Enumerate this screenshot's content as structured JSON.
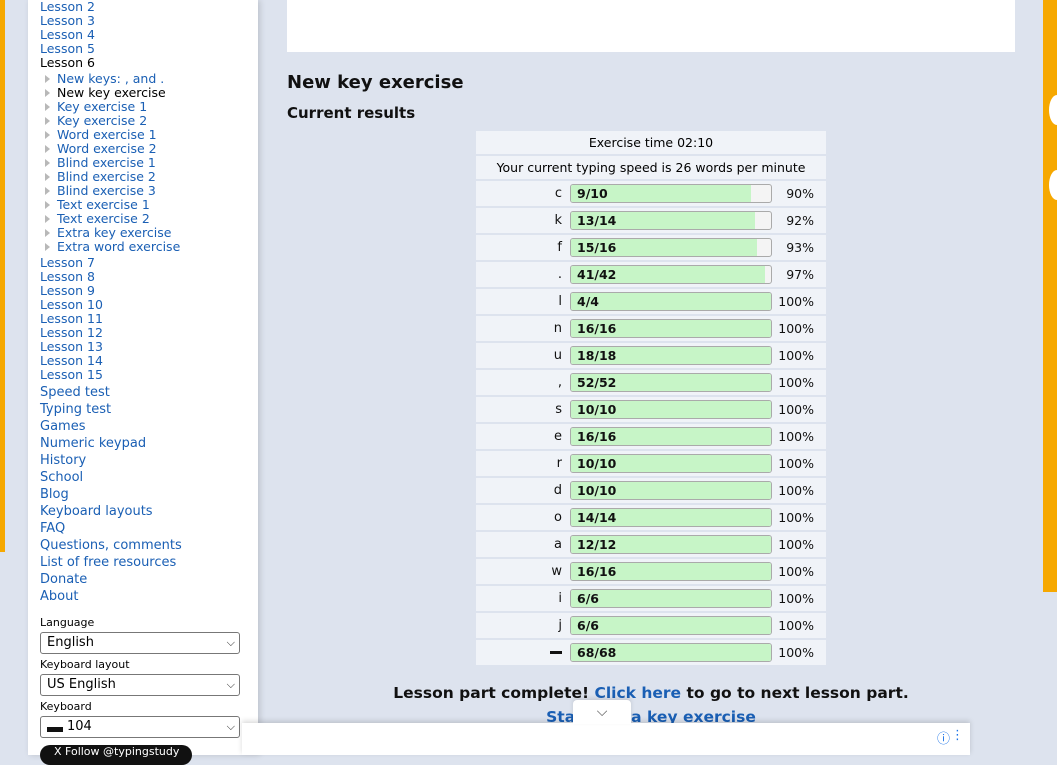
{
  "sidebar": {
    "lessons_before": [
      "Lesson 2",
      "Lesson 3",
      "Lesson 4",
      "Lesson 5"
    ],
    "current_lesson": "Lesson 6",
    "sub_items": [
      "New keys: , and .",
      "New key exercise",
      "Key exercise 1",
      "Key exercise 2",
      "Word exercise 1",
      "Word exercise 2",
      "Blind exercise 1",
      "Blind exercise 2",
      "Blind exercise 3",
      "Text exercise 1",
      "Text exercise 2",
      "Extra key exercise",
      "Extra word exercise"
    ],
    "lessons_after": [
      "Lesson 7",
      "Lesson 8",
      "Lesson 9",
      "Lesson 10",
      "Lesson 11",
      "Lesson 12",
      "Lesson 13",
      "Lesson 14",
      "Lesson 15"
    ],
    "links": [
      "Speed test",
      "Typing test",
      "Games",
      "Numeric keypad",
      "History",
      "School",
      "Blog",
      "Keyboard layouts",
      "FAQ",
      "Questions, comments",
      "List of free resources",
      "Donate",
      "About"
    ],
    "language_label": "Language",
    "language_value": "English",
    "layout_label": "Keyboard layout",
    "layout_value": "US English",
    "keyboard_label": "Keyboard",
    "keyboard_value": "104",
    "follow_label": "X Follow @typingstudy"
  },
  "main": {
    "title": "New key exercise",
    "subtitle": "Current results",
    "exercise_time": "Exercise time 02:10",
    "speed_text": "Your current typing speed is 26 words per minute",
    "complete_text": "Lesson part complete!",
    "click_here": "Click here",
    "complete_tail": "to go to next lesson part.",
    "extra_link": "Start extra key exercise"
  },
  "results": [
    {
      "key": "c",
      "score": "9/10",
      "pct": "90%",
      "fraction": 0.9
    },
    {
      "key": "k",
      "score": "13/14",
      "pct": "92%",
      "fraction": 0.92
    },
    {
      "key": "f",
      "score": "15/16",
      "pct": "93%",
      "fraction": 0.93
    },
    {
      "key": ".",
      "score": "41/42",
      "pct": "97%",
      "fraction": 0.97
    },
    {
      "key": "l",
      "score": "4/4",
      "pct": "100%",
      "fraction": 1.0
    },
    {
      "key": "n",
      "score": "16/16",
      "pct": "100%",
      "fraction": 1.0
    },
    {
      "key": "u",
      "score": "18/18",
      "pct": "100%",
      "fraction": 1.0
    },
    {
      "key": ",",
      "score": "52/52",
      "pct": "100%",
      "fraction": 1.0
    },
    {
      "key": "s",
      "score": "10/10",
      "pct": "100%",
      "fraction": 1.0
    },
    {
      "key": "e",
      "score": "16/16",
      "pct": "100%",
      "fraction": 1.0
    },
    {
      "key": "r",
      "score": "10/10",
      "pct": "100%",
      "fraction": 1.0
    },
    {
      "key": "d",
      "score": "10/10",
      "pct": "100%",
      "fraction": 1.0
    },
    {
      "key": "o",
      "score": "14/14",
      "pct": "100%",
      "fraction": 1.0
    },
    {
      "key": "a",
      "score": "12/12",
      "pct": "100%",
      "fraction": 1.0
    },
    {
      "key": "w",
      "score": "16/16",
      "pct": "100%",
      "fraction": 1.0
    },
    {
      "key": "i",
      "score": "6/6",
      "pct": "100%",
      "fraction": 1.0
    },
    {
      "key": "j",
      "score": "6/6",
      "pct": "100%",
      "fraction": 1.0
    },
    {
      "key": "space",
      "score": "68/68",
      "pct": "100%",
      "fraction": 1.0
    }
  ],
  "icons": {
    "select_chevron": "chevron-down-icon",
    "collapse_ad": "chevron-down-icon",
    "ad_info": "info-icon",
    "ad_more": "more-vertical-icon",
    "tree_bullet": "triangle-right-icon",
    "space_key": "space-bar-icon"
  },
  "colors": {
    "page_bg": "#dde3ee",
    "link": "#1a5fb4",
    "bar_fill": "#c7f5c7",
    "ad_orange": "#f6a800"
  }
}
